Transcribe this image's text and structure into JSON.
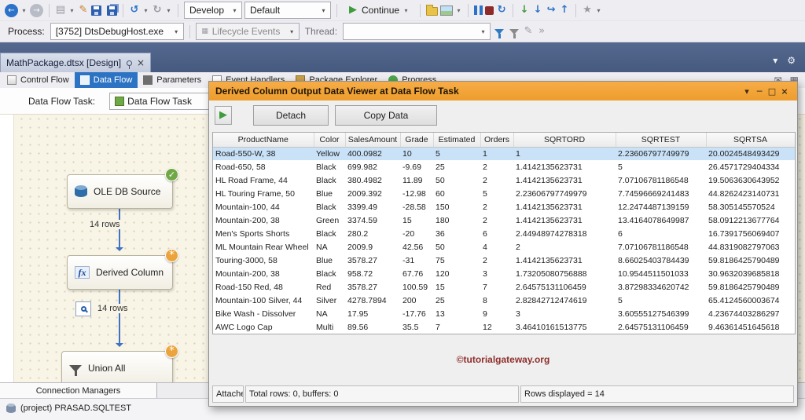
{
  "icons": {
    "caret": "▾",
    "back": "←",
    "forward": "→",
    "new_file": "▤",
    "pencil": "✎",
    "undo": "↺",
    "redo": "↻",
    "continue_play": "▶",
    "restart": "↻",
    "arrow_down": "↓",
    "arrow_up": "↑",
    "step_over": "↪",
    "star": "★",
    "overflow": "»",
    "mail": "✉",
    "grid": "▦",
    "gear": "⚙",
    "tab_close": "×",
    "check": "✓",
    "badge_star": "*",
    "minimize": "─",
    "maximize": "□",
    "close": "×",
    "viewer_play": "▶"
  },
  "toolbar": {
    "develop": "Develop",
    "default": "Default",
    "continue_label": "Continue"
  },
  "process_bar": {
    "process_label": "Process:",
    "process_value": "[3752] DtsDebugHost.exe",
    "lifecycle": "Lifecycle Events",
    "thread_label": "Thread:"
  },
  "document_tab": {
    "title": "MathPackage.dtsx [Design]"
  },
  "design_tabs": {
    "selected": "Data Flow",
    "items": [
      {
        "label": "Control Flow"
      },
      {
        "label": "Data Flow"
      },
      {
        "label": "Parameters"
      },
      {
        "label": "Event Handlers"
      },
      {
        "label": "Package Explorer"
      },
      {
        "label": "Progress"
      }
    ]
  },
  "task_selector": {
    "label": "Data Flow Task:",
    "value": "Data Flow Task"
  },
  "canvas": {
    "nodes": [
      {
        "label": "OLE DB Source"
      },
      {
        "label": "Derived Column"
      },
      {
        "label": "Union All"
      }
    ],
    "edges": [
      {
        "label": "14 rows"
      },
      {
        "label": "14 rows"
      }
    ]
  },
  "connection_managers": {
    "title": "Connection Managers",
    "items": [
      {
        "label": "(project) PRASAD.SQLTEST"
      }
    ]
  },
  "data_viewer": {
    "title": "Derived Column Output Data Viewer at Data Flow Task",
    "detach_label": "Detach",
    "copy_label": "Copy Data",
    "watermark": "©tutorialgateway.org",
    "status": {
      "attach": "Attached",
      "totals": "Total rows: 0, buffers: 0",
      "rows_displayed": "Rows displayed = 14"
    },
    "grid": {
      "columns": [
        "ProductName",
        "Color",
        "SalesAmount",
        "Grade",
        "Estimated",
        "Orders",
        "SQRTORD",
        "SQRTEST",
        "SQRTSA"
      ],
      "selected_index": 0,
      "rows": [
        [
          "Road-550-W, 38",
          "Yellow",
          "400.0982",
          "10",
          "5",
          "1",
          "1",
          "2.23606797749979",
          "20.0024548493429"
        ],
        [
          "Road-650, 58",
          "Black",
          "699.982",
          "-9.69",
          "25",
          "2",
          "1.4142135623731",
          "5",
          "26.4571729404334"
        ],
        [
          "HL Road Frame, 44",
          "Black",
          "380.4982",
          "11.89",
          "50",
          "2",
          "1.4142135623731",
          "7.07106781186548",
          "19.5063630643952"
        ],
        [
          "HL Touring Frame, 50",
          "Blue",
          "2009.392",
          "-12.98",
          "60",
          "5",
          "2.23606797749979",
          "7.74596669241483",
          "44.8262423140731"
        ],
        [
          "Mountain-100, 44",
          "Black",
          "3399.49",
          "-28.58",
          "150",
          "2",
          "1.4142135623731",
          "12.2474487139159",
          "58.305145570524"
        ],
        [
          "Mountain-200, 38",
          "Green",
          "3374.59",
          "15",
          "180",
          "2",
          "1.4142135623731",
          "13.4164078649987",
          "58.0912213677764"
        ],
        [
          "Men's Sports Shorts",
          "Black",
          "280.2",
          "-20",
          "36",
          "6",
          "2.44948974278318",
          "6",
          "16.7391756069407"
        ],
        [
          "ML Mountain Rear Wheel",
          "NA",
          "2009.9",
          "42.56",
          "50",
          "4",
          "2",
          "7.07106781186548",
          "44.8319082797063"
        ],
        [
          "Touring-3000, 58",
          "Blue",
          "3578.27",
          "-31",
          "75",
          "2",
          "1.4142135623731",
          "8.66025403784439",
          "59.8186425790489"
        ],
        [
          "Mountain-200, 38",
          "Black",
          "958.72",
          "67.76",
          "120",
          "3",
          "1.73205080756888",
          "10.9544511501033",
          "30.9632039685818"
        ],
        [
          "Road-150 Red, 48",
          "Red",
          "3578.27",
          "100.59",
          "15",
          "7",
          "2.64575131106459",
          "3.87298334620742",
          "59.8186425790489"
        ],
        [
          "Mountain-100 Silver, 44",
          "Silver",
          "4278.7894",
          "200",
          "25",
          "8",
          "2.82842712474619",
          "5",
          "65.4124560003674"
        ],
        [
          "Bike Wash - Dissolver",
          "NA",
          "17.95",
          "-17.76",
          "13",
          "9",
          "3",
          "3.60555127546399",
          "4.23674403286297"
        ],
        [
          "AWC Logo Cap",
          "Multi",
          "89.56",
          "35.5",
          "7",
          "12",
          "3.46410161513775",
          "2.64575131106459",
          "9.46361451645618"
        ]
      ]
    }
  }
}
